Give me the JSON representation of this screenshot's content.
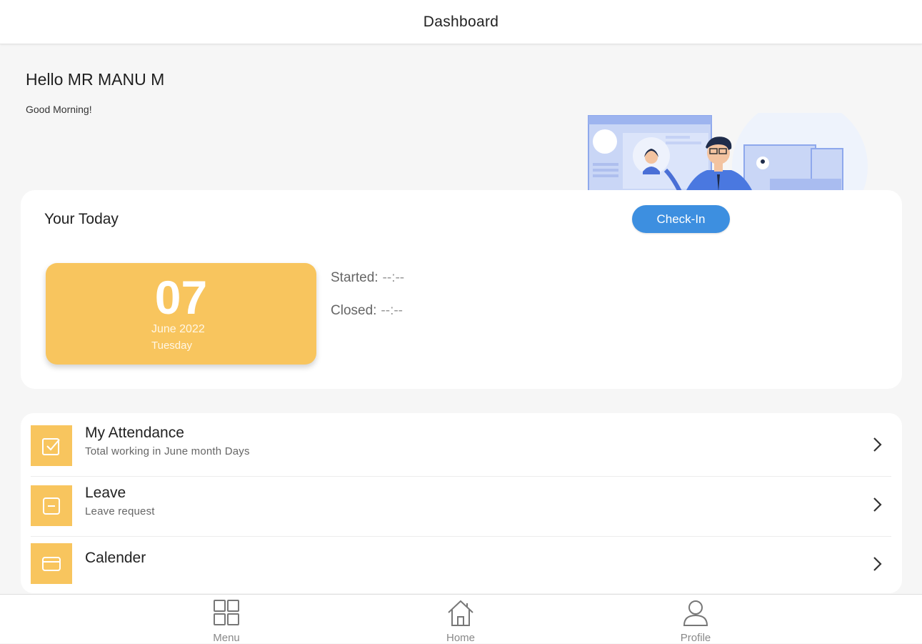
{
  "header": {
    "title": "Dashboard"
  },
  "greeting": {
    "hello": "Hello MR MANU M",
    "subtitle": "Good Morning!"
  },
  "today": {
    "title": "Your Today",
    "checkin_label": "Check-In",
    "date": {
      "day": "07",
      "month_year": "June 2022",
      "weekday": "Tuesday"
    },
    "started_label": "Started:",
    "started_value": "--:--",
    "closed_label": "Closed:",
    "closed_value": "--:--"
  },
  "menu_items": [
    {
      "label": "My Attendance",
      "subtitle": "Total working in June month Days",
      "icon": "check-square-icon"
    },
    {
      "label": "Leave",
      "subtitle": "Leave request",
      "icon": "minus-square-icon"
    },
    {
      "label": "Calender",
      "subtitle": "",
      "icon": "card-icon"
    }
  ],
  "bottom_nav": [
    {
      "label": "Menu",
      "icon": "grid-icon"
    },
    {
      "label": "Home",
      "icon": "home-icon"
    },
    {
      "label": "Profile",
      "icon": "user-icon"
    }
  ],
  "colors": {
    "accent_yellow": "#f8c55e",
    "button_blue": "#3d8fe0",
    "background": "#f6f6f6"
  }
}
